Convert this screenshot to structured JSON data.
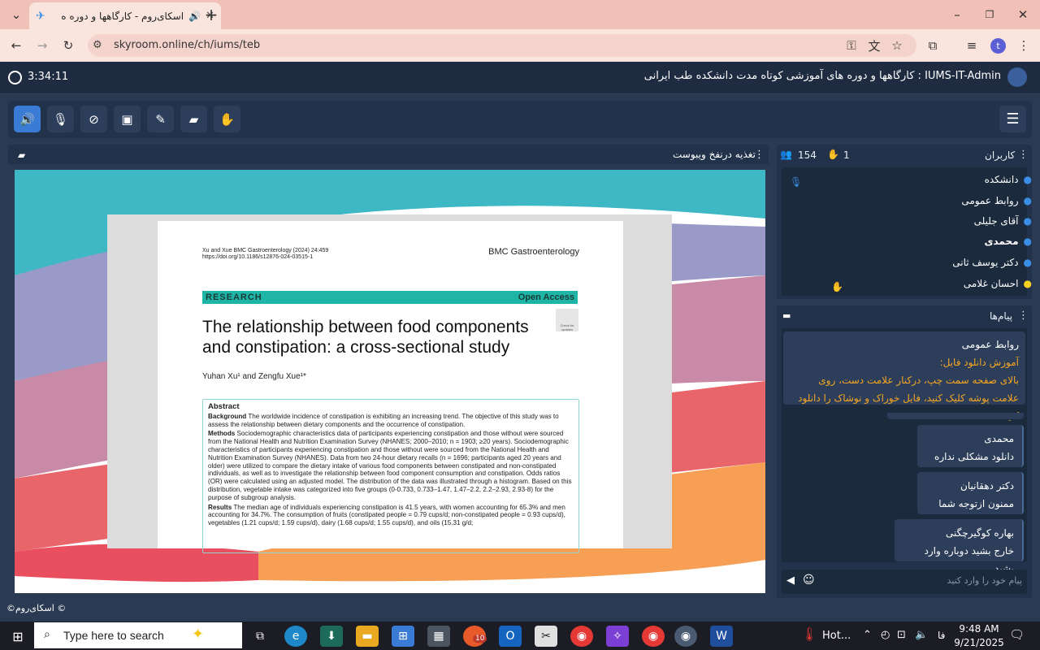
{
  "browser": {
    "tab_title": "اسکای‌روم - کارگاهها و دوره ه",
    "new_tab": "+",
    "url": "skyroom.online/ch/iums/teb",
    "profile_initial": "t"
  },
  "app": {
    "title": "IUMS-IT-Admin : کارگاهها و دوره های آموزشی کوتاه مدت دانشکده طب ایرانی",
    "session_time": "3:34:11"
  },
  "stage": {
    "title": "تغذیه درنفخ ویبوست"
  },
  "paper": {
    "journal_ref": "Xu and Xue BMC Gastroenterology (2024) 24:459",
    "doi": "https://doi.org/10.1186/s12876-024-03515-1",
    "journal": "BMC Gastroenterology",
    "section": "RESEARCH",
    "access": "Open Access",
    "check": "Check for updates",
    "title_line1": "The relationship between food components",
    "title_line2": "and constipation: a cross-sectional study",
    "authors": "Yuhan Xu¹ and Zengfu Xue¹*",
    "abstract_head": "Abstract",
    "background_label": "Background",
    "background_text": "The worldwide incidence of constipation is exhibiting an increasing trend. The objective of this study was to assess the relationship between dietary components and the occurrence of constipation.",
    "methods_label": "Methods",
    "methods_text": "Sociodemographic characteristics data of participants experiencing constipation and those without were sourced from the National Health and Nutrition Examination Survey (NHANES; 2000–2010; n = 1903; ≥20 years). Sociodemographic characteristics of participants experiencing constipation and those without were sourced from the National Health and Nutrition Examination Survey (NHANES). Data from two 24-hour dietary recalls (n = 1696; participants aged 20 years and older) were utilized to compare the dietary intake of various food components between constipated and non-constipated individuals, as well as to investigate the relationship between food component consumption and constipation. Odds ratios (OR) were calculated using an adjusted model. The distribution of the data was illustrated through a histogram. Based on this distribution, vegetable intake was categorized into five groups (0-0.733, 0.733–1.47, 1.47–2.2, 2.2–2.93, 2.93-8) for the purpose of subgroup analysis.",
    "results_label": "Results",
    "results_text": "The median age of individuals experiencing constipation is 41.5 years, with women accounting for 65.3% and men accounting for 34.7%. The consumption of fruits (constipated people = 0.79 cups/d; non-constipated people = 0.93 cups/d), vegetables (1.21 cups/d; 1.59 cups/d), dairy (1.68 cups/d; 1.55 cups/d), and oils (15.31 g/d;"
  },
  "users": {
    "title": "کاربران",
    "count": "154",
    "hands": "1",
    "list": [
      "دانشکده",
      "روابط عمومی",
      "آقای جلیلی",
      "محمدی",
      "دکتر یوسف ثانی",
      "احسان غلامی"
    ]
  },
  "chat": {
    "title": "پیام‌ها",
    "pinned_sender": "روابط عمومی",
    "pinned_line1": "آموزش دانلود فایل:",
    "pinned_line2": "بالای صفحه سمت چپ، درکنار علامت دست، روی علامت پوشه کلیک کنید، فایل خوراک و نوشاک را دانلود کنید",
    "messages": [
      {
        "sender": "محمدی",
        "text": "دانلود مشکلی نداره"
      },
      {
        "sender": "دکتر دهقانیان",
        "text": "ممنون ازتوجه شما"
      },
      {
        "sender": "بهاره کوگیرچگنی",
        "text": "خارج بشید دوباره وارد بشید"
      }
    ],
    "input_placeholder": "پیام خود را وارد کنید"
  },
  "footer_brand": "©اسکای‌روم ©",
  "taskbar": {
    "search_placeholder": "Type here to search",
    "weather": "Hot...",
    "lang": "فا",
    "time": "9:48 AM",
    "date": "9/21/2025",
    "badge": "10"
  },
  "colors": {
    "accent": "#3a7bd5",
    "user_icon": "#3a8ee6",
    "highlight": "#f5a623",
    "teal": "#1fb5a6"
  }
}
